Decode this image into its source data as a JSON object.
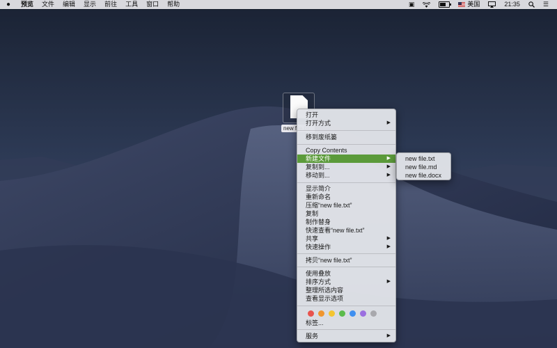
{
  "menubar": {
    "apple_icon": "apple-logo-icon",
    "items": [
      "预览",
      "文件",
      "编辑",
      "显示",
      "前往",
      "工具",
      "窗口",
      "帮助"
    ],
    "input_source": "美国",
    "time": "21:35"
  },
  "desktop": {
    "file_label": "new file.txt"
  },
  "context_menu": {
    "open": "打开",
    "open_with": "打开方式",
    "move_to_trash": "移到废纸篓",
    "copy_contents": "Copy Contents",
    "new_file": "新建文件",
    "copy_to": "复制到...",
    "move_to": "移动到...",
    "get_info": "显示简介",
    "rename": "重新命名",
    "compress": "压缩“new file.txt”",
    "duplicate": "复制",
    "make_alias": "制作替身",
    "quick_look": "快速查看“new file.txt”",
    "share": "共享",
    "quick_actions": "快速操作",
    "copy_item": "拷贝“new file.txt”",
    "use_stacks": "使用叠放",
    "sort_by": "排序方式",
    "clean_up_selection": "整理所选内容",
    "show_view_options": "查看显示选项",
    "tag_colors": [
      "#e8544e",
      "#f0962f",
      "#f4c531",
      "#5cbb4c",
      "#3f8ff0",
      "#9b6fe0",
      "#a8a8ad"
    ],
    "tags": "标签...",
    "services": "服务",
    "arrow": "▶"
  },
  "submenu": {
    "items": [
      "new file.txt",
      "new file.md",
      "new file.docx"
    ]
  }
}
